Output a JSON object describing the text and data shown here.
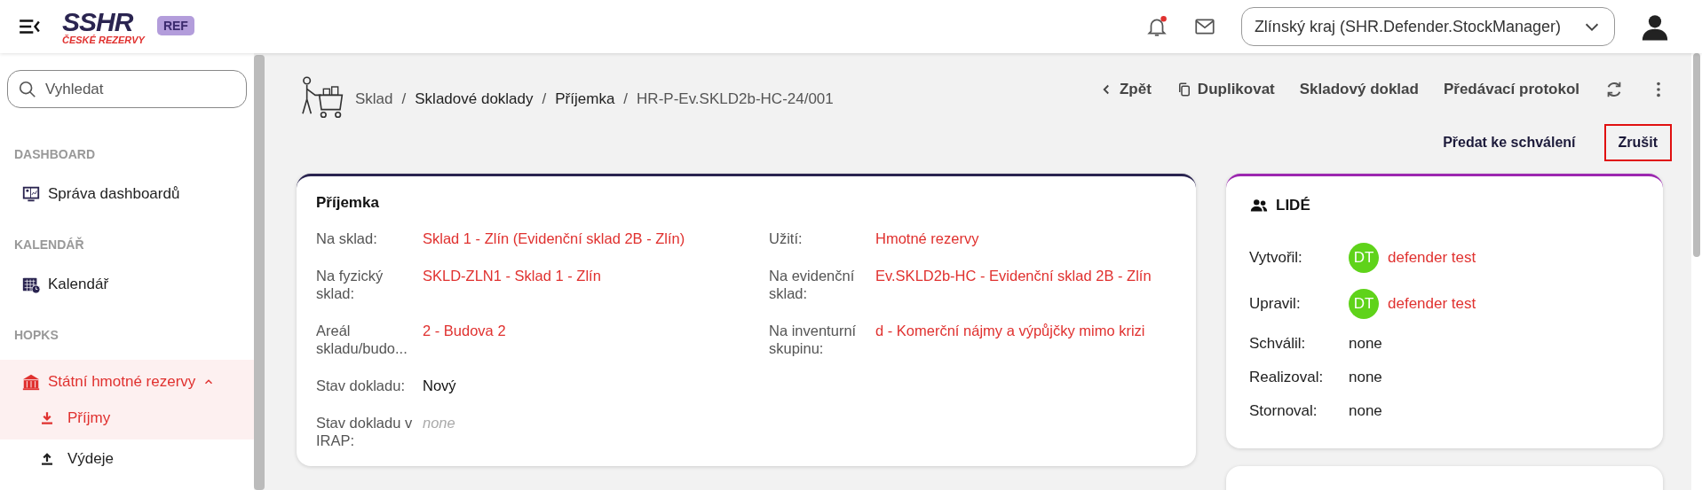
{
  "header": {
    "logo": {
      "main": "SSHR",
      "sub": "ČESKÉ REZERVY"
    },
    "env_badge": "REF",
    "notifications_unread": true,
    "role_select": {
      "value": "Zlínský kraj (SHR.Defender.StockManager)"
    }
  },
  "sidebar": {
    "search": {
      "placeholder": "Vyhledat"
    },
    "sections": [
      {
        "title": "DASHBOARD",
        "items": [
          {
            "label": "Správa dashboardů",
            "selected": false
          }
        ]
      },
      {
        "title": "KALENDÁŘ",
        "items": [
          {
            "label": "Kalendář",
            "selected": false
          }
        ]
      },
      {
        "title": "HOPKS",
        "items": [
          {
            "label": "Státní hmotné rezervy",
            "selected": true,
            "expanded": true,
            "children": [
              {
                "label": "Příjmy",
                "selected": true
              },
              {
                "label": "Výdeje",
                "selected": false
              }
            ]
          }
        ]
      }
    ]
  },
  "breadcrumb": [
    {
      "label": "Sklad",
      "link": false
    },
    {
      "separator": "/",
      "label": "Skladové doklady",
      "link": true
    },
    {
      "separator": "/",
      "label": "Příjemka",
      "link": true
    },
    {
      "separator": "/",
      "label": "HR-P-Ev.SKLD2b-HC-24/001",
      "link": false
    }
  ],
  "toolbar": [
    {
      "label": "Zpět"
    },
    {
      "label": "Duplikovat"
    },
    {
      "label": "Skladový doklad"
    },
    {
      "label": "Předávací protokol"
    }
  ],
  "actions": [
    {
      "label": "Předat ke schválení",
      "highlighted": false
    },
    {
      "label": "Zrušit",
      "highlighted": true
    }
  ],
  "document_card": {
    "title": "Příjemka",
    "columns": [
      [
        {
          "label": "Na sklad:",
          "value": "Sklad 1 - Zlín (Evidenční sklad 2B - Zlín)",
          "kind": "link"
        },
        {
          "label": "Na fyzický sklad:",
          "value": "SKLD-ZLN1 - Sklad 1 - Zlín",
          "kind": "link"
        },
        {
          "label": "Areál skladu/budo...",
          "value": "2 - Budova 2",
          "kind": "link"
        },
        {
          "label": "Stav dokladu:",
          "value": "Nový",
          "kind": "text"
        },
        {
          "label": "Stav dokladu v IRAP:",
          "value": "none",
          "kind": "empty"
        }
      ],
      [
        {
          "label": "Užití:",
          "value": "Hmotné rezervy",
          "kind": "link"
        },
        {
          "label": "Na evidenční sklad:",
          "value": "Ev.SKLD2b-HC - Evidenční sklad 2B - Zlín",
          "kind": "link"
        },
        {
          "label": "Na inventurní skupinu:",
          "value": "d - Komerční nájmy a výpůjčky mimo krizi",
          "kind": "link"
        }
      ]
    ]
  },
  "people_card": {
    "title": "LIDÉ",
    "rows": [
      {
        "label": "Vytvořil:",
        "initials": "DT",
        "value": "defender test",
        "kind": "user"
      },
      {
        "label": "Upravil:",
        "initials": "DT",
        "value": "defender test",
        "kind": "user"
      },
      {
        "label": "Schválil:",
        "value": "none",
        "kind": "text"
      },
      {
        "label": "Realizoval:",
        "value": "none",
        "kind": "text"
      },
      {
        "label": "Stornoval:",
        "value": "none",
        "kind": "text"
      }
    ]
  }
}
